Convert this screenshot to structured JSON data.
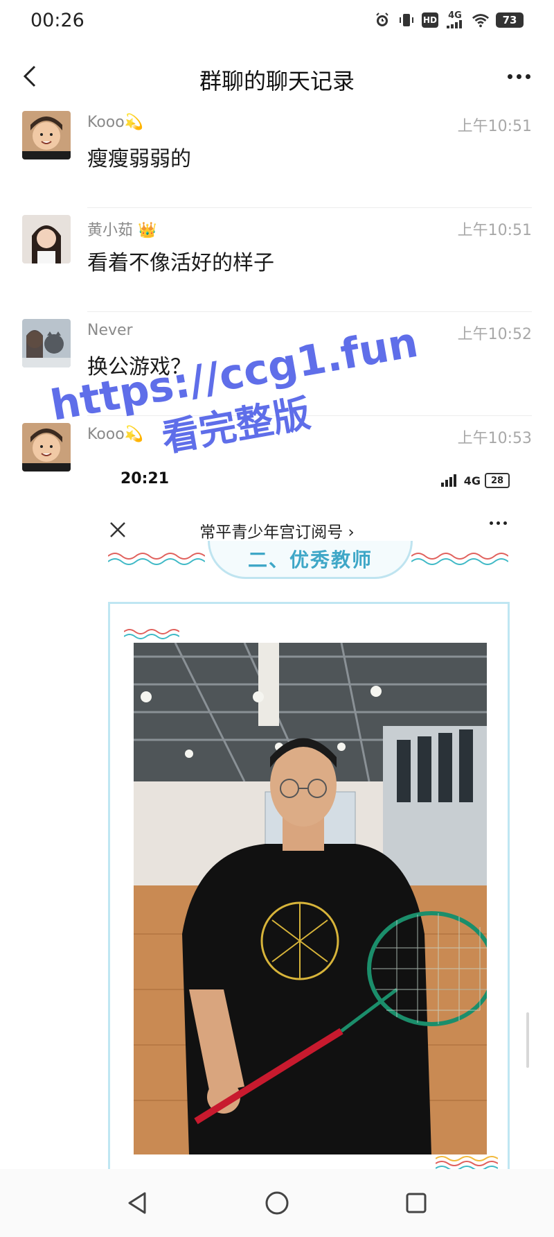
{
  "status_bar": {
    "time": "00:26",
    "network": "4G",
    "battery": "73"
  },
  "header": {
    "title": "群聊的聊天记录"
  },
  "messages": [
    {
      "sender": "Kooo💫",
      "time": "上午10:51",
      "text": "瘦瘦弱弱的"
    },
    {
      "sender": "黄小茹 👑",
      "time": "上午10:51",
      "text": "看着不像活好的样子"
    },
    {
      "sender": "Never",
      "time": "上午10:52",
      "text": "换公游戏？"
    },
    {
      "sender": "Kooo💫",
      "time": "上午10:53",
      "text": ""
    }
  ],
  "embedded": {
    "status_time": "20:21",
    "network": "4G",
    "battery": "28",
    "title": "常平青少年宫订阅号 ›",
    "section_title": "二、优秀教师"
  },
  "watermark": {
    "line1": "https://ccg1.fun",
    "line2": "看完整版"
  },
  "colors": {
    "accent_blue": "#4a5be6",
    "section_teal": "#3fa7c7",
    "text_dark": "#1a1a1a",
    "text_muted": "#8a8a8a"
  }
}
